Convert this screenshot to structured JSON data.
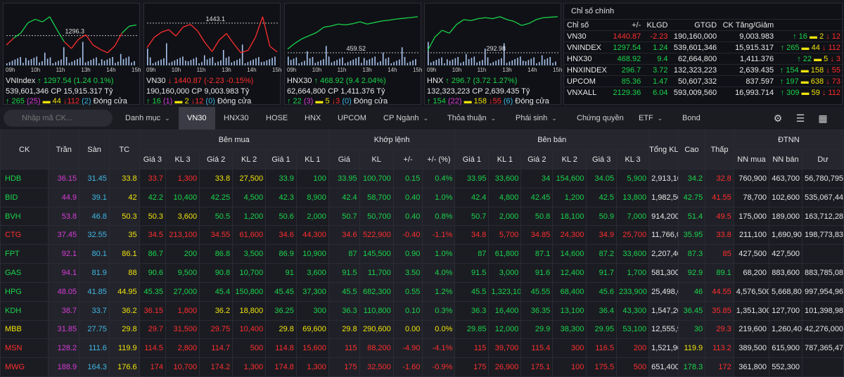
{
  "index_charts": [
    {
      "name": "VNIndex",
      "price": "1297.54",
      "change": "(1.24 0.1%)",
      "dir": "up",
      "ref_value": "1296.3",
      "volume": "539,601,346 CP",
      "value": "15,915.317 Tỷ",
      "up": "265",
      "ceil": "25",
      "unch": "44",
      "down": "112",
      "floor": "2",
      "status": "Đóng cửa",
      "hours": [
        "09h",
        "10h",
        "11h",
        "13h",
        "14h",
        "15h"
      ],
      "series": [
        1295.2,
        1296.0,
        1296.6,
        1297.8,
        1298.2,
        1297.9,
        1298.5,
        1297.0,
        1295.6,
        1294.8,
        1295.9,
        1296.4,
        1295.2,
        1294.7,
        1294.3,
        1295.1,
        1296.6,
        1297.4,
        1297.54
      ]
    },
    {
      "name": "VN30",
      "price": "1440.87",
      "change": "(-2.23 -0.15%)",
      "dir": "down",
      "ref_value": "1443.1",
      "volume": "190,160,000 CP",
      "value": "9,003.983 Tỷ",
      "up": "16",
      "ceil": "1",
      "unch": "2",
      "down": "12",
      "floor": "0",
      "status": "Đóng cửa",
      "hours": [
        "09h",
        "10h",
        "11h",
        "13h",
        "14h",
        "15h"
      ],
      "series": [
        1441.2,
        1442.0,
        1442.4,
        1442.6,
        1442.1,
        1442.8,
        1443.0,
        1442.5,
        1441.6,
        1440.9,
        1441.8,
        1442.3,
        1441.5,
        1440.8,
        1441.0,
        1442.0,
        1443.6,
        1441.3,
        1440.87
      ]
    },
    {
      "name": "HNX30",
      "price": "468.92",
      "change": "(9.4 2.04%)",
      "dir": "up",
      "ref_value": "459.52",
      "volume": "62,664,800 CP",
      "value": "1,411.376 Tỷ",
      "up": "22",
      "ceil": "3",
      "unch": "5",
      "down": "3",
      "floor": "0",
      "status": "Đóng cửa",
      "hours": [
        "09h",
        "10h",
        "11h",
        "13h",
        "14h",
        "15h"
      ],
      "series": [
        460.5,
        462.0,
        463.2,
        464.0,
        464.8,
        466.2,
        466.5,
        467.0,
        466.8,
        467.1,
        467.6,
        467.0,
        467.4,
        467.8,
        468.0,
        468.3,
        468.5,
        468.7,
        468.92
      ]
    },
    {
      "name": "HNX",
      "price": "296.7",
      "change": "(3.72 1.27%)",
      "dir": "up",
      "ref_value": "292.98",
      "volume": "132,323,223 CP",
      "value": "2,639.435 Tỷ",
      "up": "154",
      "ceil": "22",
      "unch": "158",
      "down": "55",
      "floor": "6",
      "status": "Đóng cửa",
      "hours": [
        "09h",
        "10h",
        "11h",
        "13h",
        "14h",
        "15h"
      ],
      "series": [
        293.2,
        294.6,
        295.3,
        295.0,
        295.9,
        296.4,
        296.3,
        296.5,
        296.6,
        296.5,
        296.7,
        296.4,
        296.2,
        295.8,
        296.0,
        296.4,
        296.6,
        296.65,
        296.7
      ]
    }
  ],
  "main_indices": {
    "title": "Chỉ số chính",
    "headers": [
      "Chỉ số",
      "+/-",
      "KLGD",
      "GTGD",
      "CK Tăng/Giảm"
    ],
    "rows": [
      {
        "name": "VN30",
        "value": "1440.87",
        "change": "-2.23",
        "dir": "down",
        "vol": "190,160,000",
        "gt": "9,003.983",
        "up": "16",
        "unch": "2",
        "down": "12"
      },
      {
        "name": "VNINDEX",
        "value": "1297.54",
        "change": "1.24",
        "dir": "up",
        "vol": "539,601,346",
        "gt": "15,915.317",
        "up": "265",
        "unch": "44",
        "down": "112"
      },
      {
        "name": "HNX30",
        "value": "468.92",
        "change": "9.4",
        "dir": "up",
        "vol": "62,664,800",
        "gt": "1,411.376",
        "up": "22",
        "unch": "5",
        "down": "3"
      },
      {
        "name": "HNXINDEX",
        "value": "296.7",
        "change": "3.72",
        "dir": "up",
        "vol": "132,323,223",
        "gt": "2,639.435",
        "up": "154",
        "unch": "158",
        "down": "55"
      },
      {
        "name": "UPCOM",
        "value": "85.36",
        "change": "1.47",
        "dir": "up",
        "vol": "50,607,332",
        "gt": "837.597",
        "up": "197",
        "unch": "638",
        "down": "73"
      },
      {
        "name": "VNXALL",
        "value": "2129.36",
        "change": "6.04",
        "dir": "up",
        "vol": "593,009,560",
        "gt": "16,993.714",
        "up": "309",
        "unch": "59",
        "down": "112"
      }
    ]
  },
  "nav": {
    "search_placeholder": "Nhập mã CK...",
    "items": [
      "Danh mục",
      "VN30",
      "HNX30",
      "HOSE",
      "HNX",
      "UPCOM",
      "CP Ngành",
      "Thỏa thuận",
      "Phái sinh",
      "Chứng quyền",
      "ETF",
      "Bond"
    ],
    "active": "VN30",
    "icons": [
      "gear-icon",
      "list-icon",
      "grid-icon"
    ]
  },
  "board": {
    "headers": {
      "ck": "CK",
      "tran": "Trần",
      "san": "Sàn",
      "tc": "TC",
      "ben_mua": "Bên mua",
      "khop_lenh": "Khớp lệnh",
      "ben_ban": "Bên bán",
      "tong_kl": "Tổng KL",
      "cao": "Cao",
      "thap": "Thấp",
      "dtnn": "ĐTNN"
    },
    "subheaders": [
      "Giá 3",
      "KL 3",
      "Giá 2",
      "KL 2",
      "Giá 1",
      "KL 1",
      "Giá",
      "KL",
      "+/-",
      "+/- (%)",
      "Giá 1",
      "KL 1",
      "Giá 2",
      "KL 2",
      "Giá 3",
      "KL 3",
      "NN mua",
      "NN bán",
      "Dư"
    ],
    "rows": [
      {
        "ck": "HDB",
        "tran": "36.15",
        "san": "31.45",
        "tc": "33.8",
        "b3p": "33.7",
        "b3v": "1,300",
        "b2p": "33.8",
        "b2v": "27,500",
        "b1p": "33.9",
        "b1v": "100",
        "mp": "33.95",
        "mv": "100,700",
        "chg": "0.15",
        "pct": "0.4%",
        "s1p": "33.95",
        "s1v": "33,600",
        "s2p": "34",
        "s2v": "154,600",
        "s3p": "34.05",
        "s3v": "5,900",
        "tkl": "2,913,100",
        "cao": "34.2",
        "thap": "32.8",
        "nnm": "760,900",
        "nnb": "463,700",
        "du": "56,780,795"
      },
      {
        "ck": "BID",
        "tran": "44.9",
        "san": "39.1",
        "tc": "42",
        "b3p": "42.2",
        "b3v": "10,400",
        "b2p": "42.25",
        "b2v": "4,500",
        "b1p": "42.3",
        "b1v": "8,900",
        "mp": "42.4",
        "mv": "58,700",
        "chg": "0.40",
        "pct": "1.0%",
        "s1p": "42.4",
        "s1v": "4,800",
        "s2p": "42.45",
        "s2v": "1,200",
        "s3p": "42.5",
        "s3v": "13,800",
        "tkl": "1,982,500",
        "cao": "42.75",
        "thap": "41.55",
        "nnm": "78,700",
        "nnb": "102,600",
        "du": "535,067,446"
      },
      {
        "ck": "BVH",
        "tran": "53.8",
        "san": "46.8",
        "tc": "50.3",
        "b3p": "50.3",
        "b3v": "3,600",
        "b2p": "50.5",
        "b2v": "1,200",
        "b1p": "50.6",
        "b1v": "2,000",
        "mp": "50.7",
        "mv": "50,700",
        "chg": "0.40",
        "pct": "0.8%",
        "s1p": "50.7",
        "s1v": "2,000",
        "s2p": "50.8",
        "s2v": "18,100",
        "s3p": "50.9",
        "s3v": "7,000",
        "tkl": "914,200",
        "cao": "51.4",
        "thap": "49.5",
        "nnm": "175,000",
        "nnb": "189,000",
        "du": "163,712,280"
      },
      {
        "ck": "CTG",
        "tran": "37.45",
        "san": "32.55",
        "tc": "35",
        "b3p": "34.5",
        "b3v": "213,100",
        "b2p": "34.55",
        "b2v": "61,600",
        "b1p": "34.6",
        "b1v": "44,300",
        "mp": "34.6",
        "mv": "522,900",
        "chg": "-0.40",
        "pct": "-1.1%",
        "s1p": "34.8",
        "s1v": "5,700",
        "s2p": "34.85",
        "s2v": "24,300",
        "s3p": "34.9",
        "s3v": "25,700",
        "tkl": "11,766,000",
        "cao": "35.95",
        "thap": "33.8",
        "nnm": "211,100",
        "nnb": "1,690,900",
        "du": "198,773,830"
      },
      {
        "ck": "FPT",
        "tran": "92.1",
        "san": "80.1",
        "tc": "86.1",
        "b3p": "86.7",
        "b3v": "200",
        "b2p": "86.8",
        "b2v": "3,500",
        "b1p": "86.9",
        "b1v": "10,900",
        "mp": "87",
        "mv": "145,500",
        "chg": "0.90",
        "pct": "1.0%",
        "s1p": "87",
        "s1v": "61,800",
        "s2p": "87.1",
        "s2v": "14,600",
        "s3p": "87.2",
        "s3v": "33,600",
        "tkl": "2,207,400",
        "cao": "87.3",
        "thap": "85",
        "nnm": "427,500",
        "nnb": "427,500",
        "du": ""
      },
      {
        "ck": "GAS",
        "tran": "94.1",
        "san": "81.9",
        "tc": "88",
        "b3p": "90.6",
        "b3v": "9,500",
        "b2p": "90.8",
        "b2v": "10,700",
        "b1p": "91",
        "b1v": "3,600",
        "mp": "91.5",
        "mv": "11,700",
        "chg": "3.50",
        "pct": "4.0%",
        "s1p": "91.5",
        "s1v": "3,000",
        "s2p": "91.6",
        "s2v": "12,400",
        "s3p": "91.7",
        "s3v": "1,700",
        "tkl": "581,300",
        "cao": "92.9",
        "thap": "89.1",
        "nnm": "68,200",
        "nnb": "883,600",
        "du": "883,785,082"
      },
      {
        "ck": "HPG",
        "tran": "48.05",
        "san": "41.85",
        "tc": "44.95",
        "b3p": "45.35",
        "b3v": "27,000",
        "b2p": "45.4",
        "b2v": "150,800",
        "b1p": "45.45",
        "b1v": "37,300",
        "mp": "45.5",
        "mv": "682,300",
        "chg": "0.55",
        "pct": "1.2%",
        "s1p": "45.5",
        "s1v": "1,323,100",
        "s2p": "45.55",
        "s2v": "68,400",
        "s3p": "45.6",
        "s3v": "233,900",
        "tkl": "25,498,600",
        "cao": "46",
        "thap": "44.55",
        "nnm": "4,576,500",
        "nnb": "5,668,800",
        "du": "997,954,963"
      },
      {
        "ck": "KDH",
        "tran": "38.7",
        "san": "33.7",
        "tc": "36.2",
        "b3p": "36.15",
        "b3v": "1,800",
        "b2p": "36.2",
        "b2v": "18,800",
        "b1p": "36.25",
        "b1v": "300",
        "mp": "36.3",
        "mv": "110,800",
        "chg": "0.10",
        "pct": "0.3%",
        "s1p": "36.3",
        "s1v": "16,400",
        "s2p": "36.35",
        "s2v": "13,100",
        "s3p": "36.4",
        "s3v": "43,300",
        "tkl": "1,547,200",
        "cao": "36.45",
        "thap": "35.85",
        "nnm": "1,351,300",
        "nnb": "127,700",
        "du": "101,398,980"
      },
      {
        "ck": "MBB",
        "tran": "31.85",
        "san": "27.75",
        "tc": "29.8",
        "b3p": "29.7",
        "b3v": "31,500",
        "b2p": "29.75",
        "b2v": "10,400",
        "b1p": "29.8",
        "b1v": "69,600",
        "mp": "29.8",
        "mv": "290,600",
        "chg": "0.00",
        "pct": "0.0%",
        "s1p": "29.85",
        "s1v": "12,000",
        "s2p": "29.9",
        "s2v": "38,300",
        "s3p": "29.95",
        "s3v": "53,100",
        "tkl": "12,555,900",
        "cao": "30",
        "thap": "29.3",
        "nnm": "219,600",
        "nnb": "1,260,400",
        "du": "42,276,000"
      },
      {
        "ck": "MSN",
        "tran": "128.2",
        "san": "111.6",
        "tc": "119.9",
        "b3p": "114.5",
        "b3v": "2,800",
        "b2p": "114.7",
        "b2v": "500",
        "b1p": "114.8",
        "b1v": "15,600",
        "mp": "115",
        "mv": "88,200",
        "chg": "-4.90",
        "pct": "-4.1%",
        "s1p": "115",
        "s1v": "39,700",
        "s2p": "115.4",
        "s2v": "300",
        "s3p": "116.5",
        "s3v": "200",
        "tkl": "1,521,900",
        "cao": "119.9",
        "thap": "113.2",
        "nnm": "389,500",
        "nnb": "615,900",
        "du": "787,365,470"
      },
      {
        "ck": "MWG",
        "tran": "188.9",
        "san": "164.3",
        "tc": "176.6",
        "b3p": "174",
        "b3v": "10,700",
        "b2p": "174.2",
        "b2v": "1,300",
        "b1p": "174.8",
        "b1v": "1,300",
        "mp": "175",
        "mv": "32,500",
        "chg": "-1.60",
        "pct": "-0.9%",
        "s1p": "175",
        "s1v": "26,900",
        "s2p": "175.1",
        "s2v": "100",
        "s3p": "175.5",
        "s3v": "500",
        "tkl": "651,400",
        "cao": "178.3",
        "thap": "172",
        "nnm": "361,800",
        "nnb": "552,300",
        "du": ""
      }
    ]
  },
  "colors": {
    "up": "#19d44b",
    "down": "#ff2d2d",
    "ref": "#f0e30a",
    "ceil": "#d83bd8",
    "floor": "#3fb8e6"
  }
}
